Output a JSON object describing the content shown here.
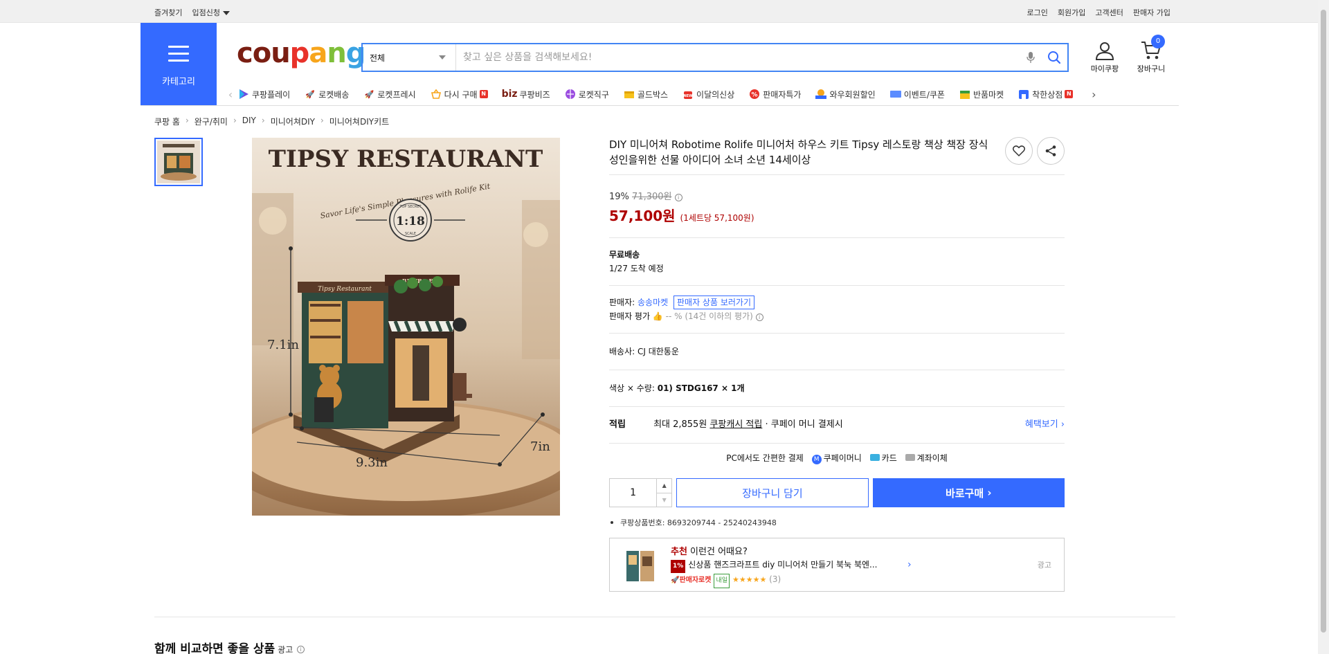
{
  "topbar": {
    "left": [
      "즐겨찾기",
      "입점신청"
    ],
    "right": [
      "로그인",
      "회원가입",
      "고객센터",
      "판매자 가입"
    ]
  },
  "header": {
    "category_label": "카테고리",
    "logo": [
      "cou",
      "p",
      "a",
      "n",
      "g"
    ],
    "search_scope": "전체",
    "search_placeholder": "찾고 싶은 상품을 검색해보세요!",
    "my_label": "마이쿠팡",
    "cart_label": "장바구니",
    "cart_count": "0"
  },
  "nav": {
    "items": [
      "쿠팡플레이",
      "로켓배송",
      "로켓프레시",
      "다시 구매",
      "쿠팡비즈",
      "로켓직구",
      "골드박스",
      "이달의신상",
      "판매자특가",
      "와우회원할인",
      "이벤트/쿠폰",
      "반품마켓",
      "착한상점"
    ],
    "biz_prefix": "biz"
  },
  "breadcrumb": [
    "쿠팡 홈",
    "완구/취미",
    "DIY",
    "미니어쳐DIY",
    "미니어쳐DIY키트"
  ],
  "image": {
    "title": "TIPSY RESTAURANT",
    "arc_text": "Savor Life's Simple Pleasures with Rolife Kit",
    "scale": "1:18",
    "scale_top": "TOP SECRET",
    "scale_bottom": "SCALE",
    "dim_h": "7.1in",
    "dim_w": "9.3in",
    "dim_d": "7in",
    "shop_sign": "Tipsy Restaurant",
    "bar_sign": "BISTRO BAR"
  },
  "product": {
    "title": "DIY 미니어쳐 Robotime Rolife 미니어처 하우스 키트 Tipsy 레스토랑 책상 책장 장식 성인을위한 선물 아이디어 소녀 소년 14세이상",
    "discount": "19%",
    "original_price": "71,300원",
    "price": "57,100원",
    "unit_price": "(1세트당 57,100원)",
    "shipping_label": "무료배송",
    "arrival": "1/27 도착 예정",
    "seller_label": "판매자:",
    "seller_name": "송송마켓",
    "seller_btn": "판매자 상품 보러가기",
    "seller_rating_label": "판매자 평가",
    "seller_rating": "-- % (14건 이하의 평가)",
    "courier": "배송사:  CJ 대한통운",
    "option_label": "색상 × 수량:",
    "option_value": "01) STDG167 × 1개",
    "reward_label": "적립",
    "reward_text_1": "최대 2,855원",
    "reward_link": "쿠팡캐시 적립",
    "reward_text_2": "· 쿠페이 머니 결제시",
    "benefit_link": "혜택보기",
    "pay_text": "PC에서도 간편한 결제",
    "pay_coupay": "쿠페이머니",
    "pay_card": "카드",
    "pay_bank": "계좌이체",
    "quantity": "1",
    "cart_button": "장바구니 담기",
    "buy_button": "바로구매",
    "product_id": "쿠팡상품번호: 8693209744 - 25240243948"
  },
  "recommend": {
    "title_prefix": "추천",
    "title_rest": " 이런건 어때요?",
    "pct": "1%",
    "name": "신상품 핸즈크라프트 diy 미니어처 만들기 북눅 북엔...",
    "rocket": "판매자로켓",
    "naeil": "내일",
    "stars": "★★★★★",
    "reviews": "(3)",
    "ad": "광고"
  },
  "compare": {
    "title": "함께 비교하면 좋을 상품",
    "ad": "광고"
  },
  "colors": {
    "accent": "#346aff",
    "price": "#ae0000"
  }
}
